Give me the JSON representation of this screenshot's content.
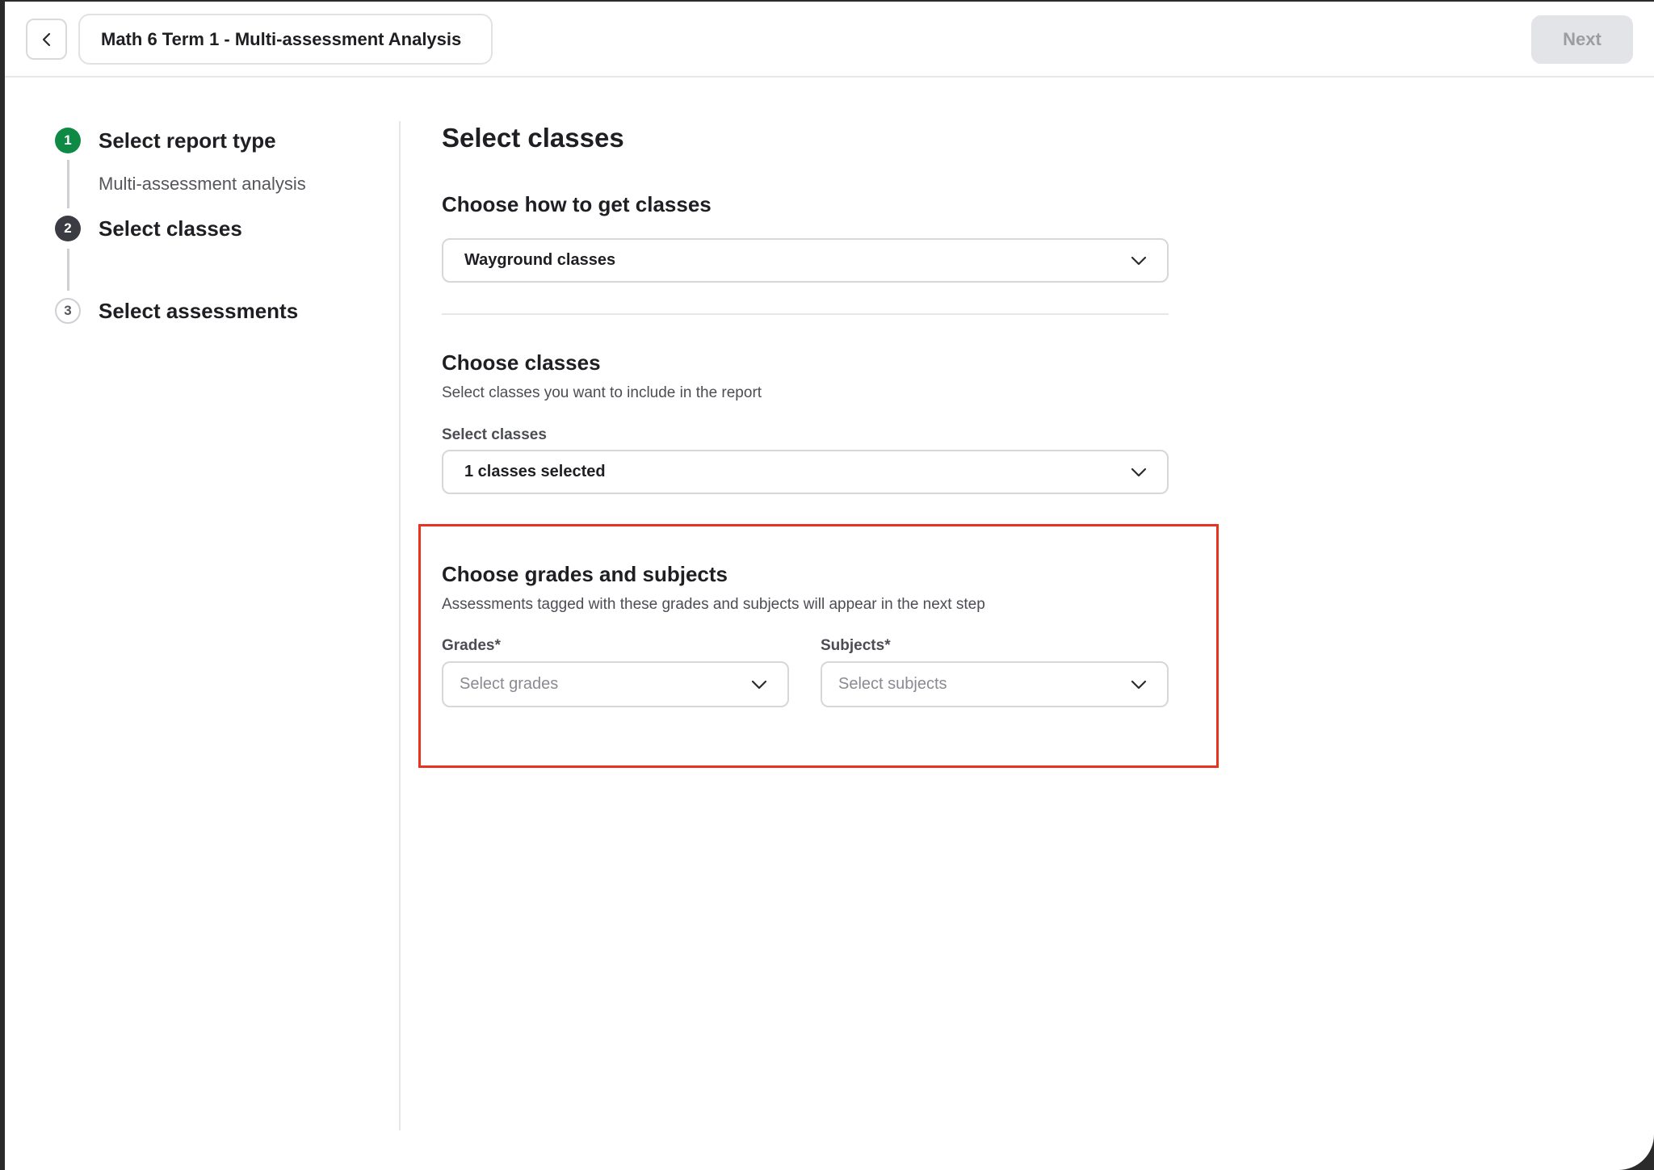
{
  "header": {
    "back_label": "",
    "title": "Math 6 Term 1 - Multi-assessment Analysis",
    "next_label": "Next"
  },
  "stepper": {
    "steps": [
      {
        "number": "1",
        "title": "Select report type",
        "subtitle": "Multi-assessment analysis",
        "state": "done"
      },
      {
        "number": "2",
        "title": "Select classes",
        "subtitle": "",
        "state": "active"
      },
      {
        "number": "3",
        "title": "Select assessments",
        "subtitle": "",
        "state": "todo"
      }
    ]
  },
  "main": {
    "title": "Select classes",
    "source": {
      "heading": "Choose how to get classes",
      "selected": "Wayground classes"
    },
    "classes": {
      "heading": "Choose classes",
      "description": "Select classes you want to include in the report",
      "field_label": "Select classes",
      "selected": "1 classes selected"
    },
    "grades_subjects": {
      "heading": "Choose grades and subjects",
      "description": "Assessments tagged with these grades and subjects will appear in the next step",
      "grades_label": "Grades*",
      "grades_placeholder": "Select grades",
      "subjects_label": "Subjects*",
      "subjects_placeholder": "Select subjects"
    }
  },
  "colors": {
    "step_done": "#0f8a45",
    "step_active": "#3b3c43",
    "highlight": "#e8331f",
    "next_disabled_bg": "#e3e4e7"
  },
  "icons": {
    "back": "chevron-left-icon",
    "dropdown": "chevron-down-icon"
  }
}
